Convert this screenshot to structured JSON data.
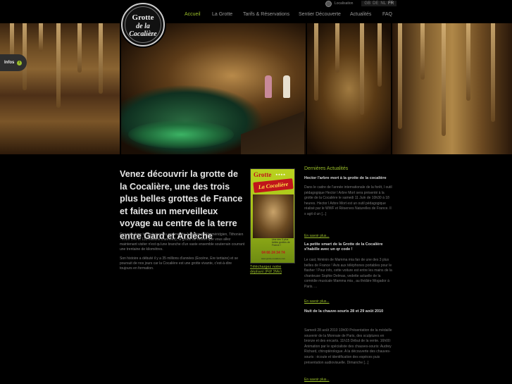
{
  "logo": {
    "line1": "Grotte",
    "line2": "de la Cocalière",
    "line3": "Gard · Cévennes"
  },
  "topbar": {
    "location_label": "Localisation",
    "languages": [
      "GB",
      "DE",
      "NL",
      "FR"
    ],
    "active_language": "FR"
  },
  "nav": {
    "items": [
      "Accueil",
      "La Grotte",
      "Tarifs & Réservations",
      "Sentier Découverte",
      "Actualités",
      "FAQ"
    ],
    "active": "Accueil"
  },
  "infos_tab": {
    "label": "Infos",
    "icon": "info-icon"
  },
  "intro": {
    "heading": "Venez découvrir la grotte de la Cocalière, une des trois plus belles grottes de France et faites un merveilleux voyage au centre de la terre entre Gard et Ardèche",
    "p1": "Creusée dans les calcaires du sommet du Jurassique (Kimméridgien, Tithonien - entre 146 et 135 millions d'années), la grotte de renom que vous allez maintenant visiter n'est qu'une branche d'un vaste ensemble souterrain courrant une trentaine de kilomètres.",
    "p2": "Son histoire a débuté il y a 35 millions d'années (Eocène, Ere tertiaire) et se poursuit de nos jours car la Cocalière est une grotte vivante, c'est-à-dire toujours en formation."
  },
  "brochure": {
    "title": "Grotte",
    "stars": "★★★★",
    "subtitle": "La Cocalière",
    "caption": "Une des 3 plus belles grottes de France !",
    "phone": "04 66 24 34 74",
    "website": "www.grotte-cocaliere.com",
    "download_link": "Téléchargez notre dépliant (Pdf 3Mo)"
  },
  "news": {
    "title": "Dernières Actualités",
    "read_more": "En savoir plus...",
    "items": [
      {
        "headline": "Hector l'arbre mort à la grotte de la cocalière",
        "body": "Dans le cadre de l'année internationale de la forêt, l outil pédagogique Hector l Arbre Mort sera présenté à la grotte de la Cocalière le samedi 11 Juin de 10h30 à 18 heures. Hector l Arbre Mort est un outil pédagogique réalisé par le WWF et Réserves Naturelles de France. Il s agit d un [...]"
      },
      {
        "headline": "La petite smart de la Grotte de la Cocalière s'habille avec un qr code !",
        "body": "Le cast, féminin de Mamma mia  fan de  une des 3  plus belles de France  ! Avis aux téléphones portables pour le flasher ! Pour info, cette voiture est entre les mains de la chanteuse Sophie Delmas, vedette actuelle de la comédie musicale  Mamma mia ,  au théâtre Mogador à Paris. ..."
      },
      {
        "headline": "Nuit de la chauve-souris 28 et 29 août 2010",
        "body": "Samedi 28 août 2010       10h00   Présentation de la médaille  souvenir de la Monnaie de Paris, des sculptures en bronze et des encarts.  11h15   Début de la vente.   16h00: Animation par le spécialiste des chauves-souris: Audrey Richard, chiroptérologue.  A la découverte des chauves-souris : écoute et identification des espèces puis présentation audiovisuelle. Dimanche [...]"
      }
    ]
  }
}
